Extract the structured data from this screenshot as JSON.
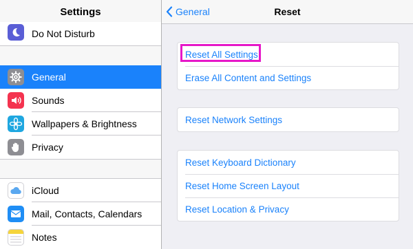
{
  "sidebar": {
    "title": "Settings",
    "items": [
      {
        "label": "Do Not Disturb",
        "icon": "moon-icon",
        "color": "#5a5ed6"
      },
      {
        "label": "General",
        "icon": "gear-icon",
        "color": "#8e8e93",
        "selected": true
      },
      {
        "label": "Sounds",
        "icon": "speaker-icon",
        "color": "#f4334f"
      },
      {
        "label": "Wallpapers & Brightness",
        "icon": "flower-icon",
        "color": "#1fa7e0"
      },
      {
        "label": "Privacy",
        "icon": "hand-icon",
        "color": "#8e8e93"
      },
      {
        "label": "iCloud",
        "icon": "cloud-icon",
        "color": "#ffffff"
      },
      {
        "label": "Mail, Contacts, Calendars",
        "icon": "mail-icon",
        "color": "#1f8ef5"
      },
      {
        "label": "Notes",
        "icon": "notes-icon",
        "color": "#f5d43b"
      }
    ]
  },
  "header": {
    "back_label": "General",
    "title": "Reset"
  },
  "groups": [
    [
      "Reset All Settings",
      "Erase All Content and Settings"
    ],
    [
      "Reset Network Settings"
    ],
    [
      "Reset Keyboard Dictionary",
      "Reset Home Screen Layout",
      "Reset Location & Privacy"
    ]
  ],
  "colors": {
    "accent": "#1a82fb",
    "highlight": "#e617c8"
  }
}
